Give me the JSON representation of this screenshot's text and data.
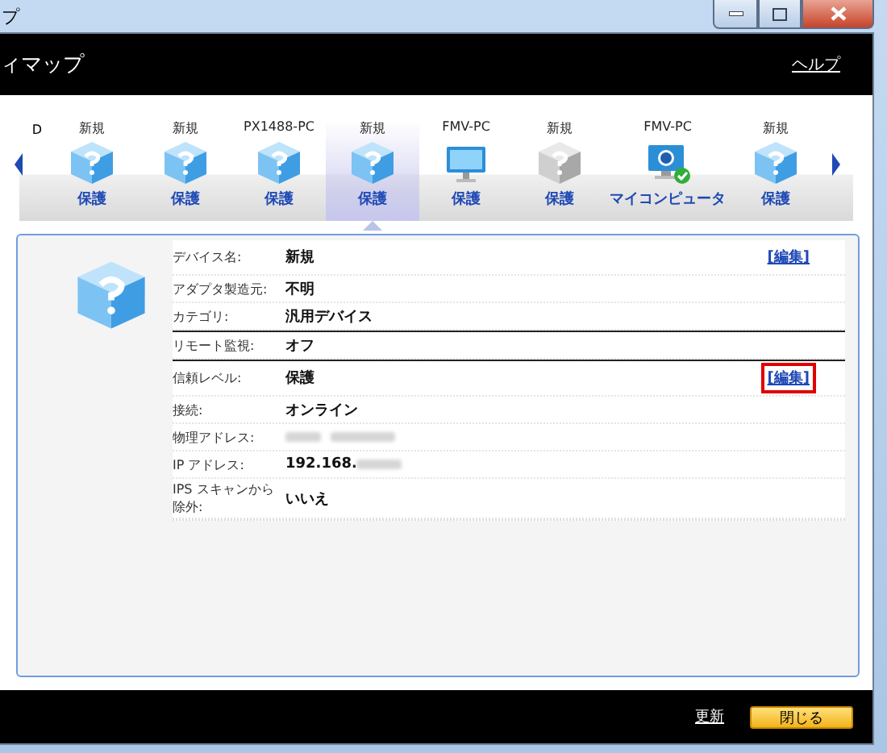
{
  "window": {
    "title": "プ"
  },
  "header": {
    "title": "ィマップ",
    "help_link": "ヘルプ"
  },
  "device_strip": {
    "cut_label": "D",
    "devices": [
      {
        "name": "新規",
        "status": "保護",
        "kind": "unknown",
        "selected": false
      },
      {
        "name": "新規",
        "status": "保護",
        "kind": "unknown",
        "selected": false
      },
      {
        "name": "PX1488-PC",
        "status": "保護",
        "kind": "unknown",
        "selected": false
      },
      {
        "name": "新規",
        "status": "保護",
        "kind": "unknown",
        "selected": true
      },
      {
        "name": "FMV-PC",
        "status": "保護",
        "kind": "monitor",
        "selected": false
      },
      {
        "name": "新規",
        "status": "保護",
        "kind": "inactive",
        "selected": false
      },
      {
        "name": "FMV-PC",
        "status": "マイコンピュータ",
        "kind": "self",
        "selected": false
      },
      {
        "name": "新規",
        "status": "保護",
        "kind": "unknown",
        "selected": false
      }
    ]
  },
  "details": {
    "groups": [
      [
        {
          "label": "デバイス名:",
          "value": "新規",
          "edit": "[編集]",
          "highlighted": false
        },
        {
          "label": "アダプタ製造元:",
          "value": "不明"
        },
        {
          "label": "カテゴリ:",
          "value": "汎用デバイス"
        }
      ],
      [
        {
          "label": "リモート監視:",
          "value": "オフ"
        }
      ],
      [
        {
          "label": "信頼レベル:",
          "value": "保護",
          "edit": "[編集]",
          "highlighted": true
        },
        {
          "label": "接続:",
          "value": "オンライン"
        },
        {
          "label": "物理アドレス:",
          "blurred": true
        },
        {
          "label": "IP アドレス:",
          "value": "192.168.",
          "blurred": true
        },
        {
          "label": "IPS スキャンから除外:",
          "value": "いいえ"
        }
      ]
    ]
  },
  "footer": {
    "refresh_link": "更新",
    "close_button": "閉じる"
  }
}
